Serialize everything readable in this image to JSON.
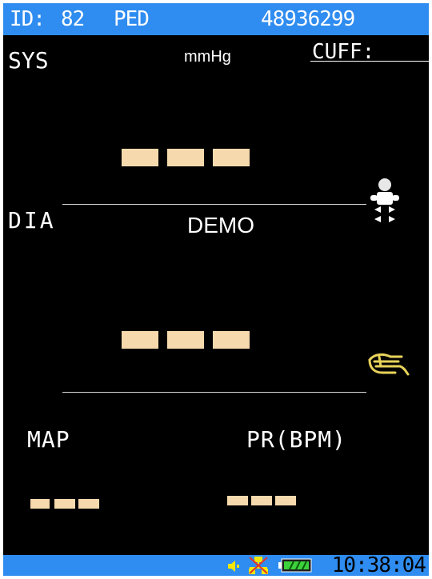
{
  "header": {
    "id_label": "ID:",
    "id_value": "82",
    "patient_type": "PED",
    "serial_number": "48936299"
  },
  "sys": {
    "label": "SYS",
    "unit": "mmHg",
    "value": "---"
  },
  "cuff": {
    "label": "CUFF:"
  },
  "dia": {
    "label": "DIA",
    "value": "---"
  },
  "mode": {
    "label": "DEMO"
  },
  "map": {
    "label": "MAP",
    "value": "---"
  },
  "pr": {
    "label": "PR(BPM)",
    "value": "---"
  },
  "status": {
    "time": "10:38:04",
    "icons": [
      "speaker-icon",
      "network-disconnected-icon",
      "battery-icon"
    ]
  },
  "side_icons": [
    "pediatric-patient-icon",
    "cuff-hand-icon"
  ],
  "colors": {
    "header_bar": "#2f8cf0",
    "background": "#000000",
    "placeholder_dash": "#f6d9ad"
  }
}
